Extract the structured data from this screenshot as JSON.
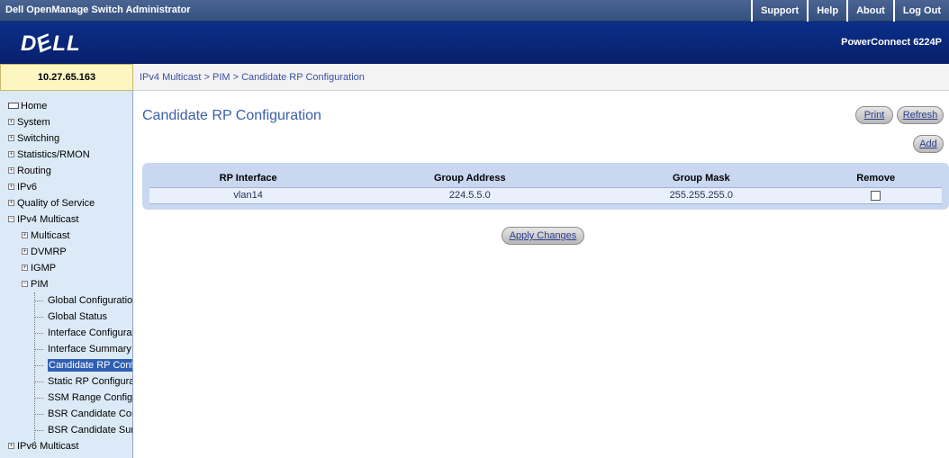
{
  "header": {
    "app_title": "Dell OpenManage Switch Administrator",
    "links": [
      "Support",
      "Help",
      "About",
      "Log Out"
    ],
    "logo": "DELL",
    "model": "PowerConnect 6224P"
  },
  "ip_address": "10.27.65.163",
  "breadcrumb": "IPv4 Multicast > PIM > Candidate RP Configuration",
  "sidebar": {
    "items": [
      {
        "label": "Home"
      },
      {
        "label": "System"
      },
      {
        "label": "Switching"
      },
      {
        "label": "Statistics/RMON"
      },
      {
        "label": "Routing"
      },
      {
        "label": "IPv6"
      },
      {
        "label": "Quality of Service"
      },
      {
        "label": "IPv4 Multicast"
      },
      {
        "label": "Multicast"
      },
      {
        "label": "DVMRP"
      },
      {
        "label": "IGMP"
      },
      {
        "label": "PIM"
      },
      {
        "label": "Global Configuration"
      },
      {
        "label": "Global Status"
      },
      {
        "label": "Interface Configurati"
      },
      {
        "label": "Interface Summary"
      },
      {
        "label": "Candidate RP Confi"
      },
      {
        "label": "Static RP Configura"
      },
      {
        "label": "SSM Range Configu"
      },
      {
        "label": "BSR Candidate Cor"
      },
      {
        "label": "BSR Candidate Sur"
      },
      {
        "label": "IPv6 Multicast"
      }
    ]
  },
  "main": {
    "title": "Candidate RP Configuration",
    "buttons": {
      "print": "Print",
      "refresh": "Refresh",
      "add": "Add",
      "apply": "Apply Changes"
    },
    "table": {
      "headers": [
        "RP Interface",
        "Group Address",
        "Group Mask",
        "Remove"
      ],
      "rows": [
        {
          "interface": "vlan14",
          "group_address": "224.5.5.0",
          "group_mask": "255.255.255.0",
          "remove": false
        }
      ]
    }
  }
}
